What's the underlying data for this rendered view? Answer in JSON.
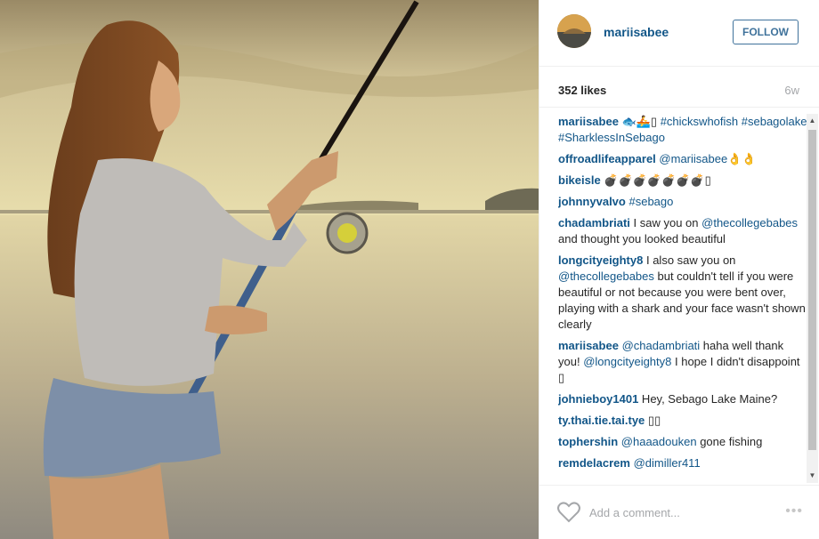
{
  "post": {
    "username": "mariisabee",
    "follow_label": "FOLLOW",
    "likes": "352 likes",
    "age": "6w"
  },
  "comments": [
    {
      "user": "mariisabee",
      "parts": [
        {
          "t": "text",
          "v": " 🐟🚣▯ "
        },
        {
          "t": "link",
          "v": "#chickswhofish"
        },
        {
          "t": "text",
          "v": " "
        },
        {
          "t": "link",
          "v": "#sebagolake"
        },
        {
          "t": "text",
          "v": " "
        },
        {
          "t": "link",
          "v": "#SharklessInSebago"
        }
      ]
    },
    {
      "user": "offroadlifeapparel",
      "parts": [
        {
          "t": "text",
          "v": " "
        },
        {
          "t": "link",
          "v": "@mariisabee"
        },
        {
          "t": "text",
          "v": "👌👌"
        }
      ]
    },
    {
      "user": "bikeisle",
      "parts": [
        {
          "t": "text",
          "v": " 💣💣💣💣💣💣💣▯"
        }
      ]
    },
    {
      "user": "johnnyvalvo",
      "parts": [
        {
          "t": "text",
          "v": " "
        },
        {
          "t": "link",
          "v": "#sebago"
        }
      ]
    },
    {
      "user": "chadambriati",
      "parts": [
        {
          "t": "text",
          "v": " I saw you on "
        },
        {
          "t": "link",
          "v": "@thecollegebabes"
        },
        {
          "t": "text",
          "v": " and thought you looked beautiful"
        }
      ]
    },
    {
      "user": "longcityeighty8",
      "parts": [
        {
          "t": "text",
          "v": " I also saw you on "
        },
        {
          "t": "link",
          "v": "@thecollegebabes"
        },
        {
          "t": "text",
          "v": " but couldn't tell if you were beautiful or not because you were bent over, playing with a shark and your face wasn't shown clearly"
        }
      ]
    },
    {
      "user": "mariisabee",
      "parts": [
        {
          "t": "text",
          "v": " "
        },
        {
          "t": "link",
          "v": "@chadambriati"
        },
        {
          "t": "text",
          "v": " haha well thank you! "
        },
        {
          "t": "link",
          "v": "@longcityeighty8"
        },
        {
          "t": "text",
          "v": " I hope I didn't disappoint ▯"
        }
      ]
    },
    {
      "user": "johnieboy1401",
      "parts": [
        {
          "t": "text",
          "v": " Hey, Sebago Lake Maine?"
        }
      ]
    },
    {
      "user": "ty.thai.tie.tai.tye",
      "parts": [
        {
          "t": "text",
          "v": " ▯▯"
        }
      ]
    },
    {
      "user": "tophershin",
      "parts": [
        {
          "t": "text",
          "v": " "
        },
        {
          "t": "link",
          "v": "@haaadouken"
        },
        {
          "t": "text",
          "v": " gone fishing"
        }
      ]
    },
    {
      "user": "remdelacrem",
      "parts": [
        {
          "t": "text",
          "v": " "
        },
        {
          "t": "link",
          "v": "@dimiller411"
        }
      ]
    }
  ],
  "add_comment_placeholder": "Add a comment...",
  "more_label": "•••",
  "icons": {
    "heart": "heart-icon",
    "more": "more-options-icon",
    "scroll_up": "scroll-up-arrow-icon",
    "scroll_down": "scroll-down-arrow-icon"
  },
  "colors": {
    "username": "#125688",
    "follow": "#3f729b",
    "muted": "#a5a7aa"
  }
}
